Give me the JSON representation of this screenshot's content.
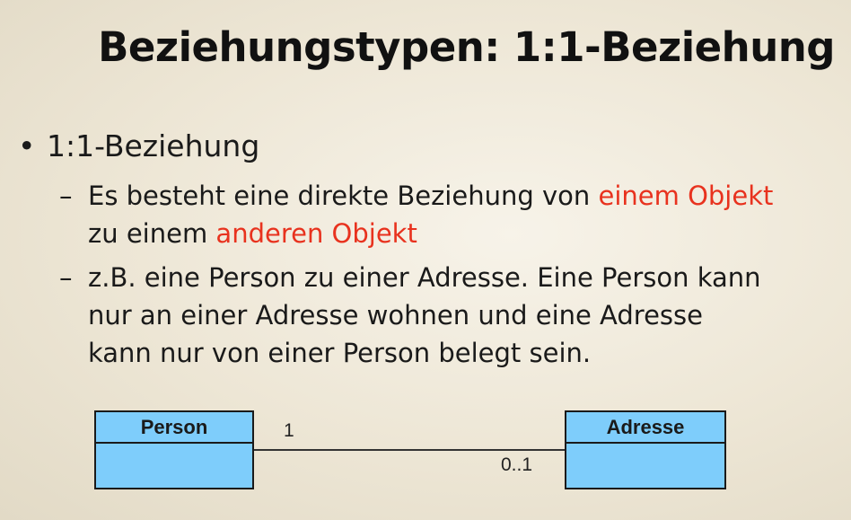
{
  "slide": {
    "title": "Beziehungstypen: 1:1-Beziehung"
  },
  "content": {
    "bullet": "1:1-Beziehung",
    "bullet_marker": "•",
    "dash_marker": "–",
    "sub1": {
      "line1_plain": "Es besteht eine direkte Beziehung von ",
      "line1_highlight": "einem Objekt",
      "line2_plain": "zu einem ",
      "line2_highlight": "anderen Objekt"
    },
    "sub2": {
      "line1": "z.B. eine Person zu einer Adresse. Eine Person kann",
      "line2": "nur an einer Adresse wohnen und eine Adresse",
      "line3": "kann nur von einer Person belegt sein."
    }
  },
  "diagram": {
    "class_left": "Person",
    "class_right": "Adresse",
    "multiplicity_left": "1",
    "multiplicity_right": "0..1",
    "class_fill": "#7ecdfb",
    "highlight_color": "#e8321e"
  }
}
